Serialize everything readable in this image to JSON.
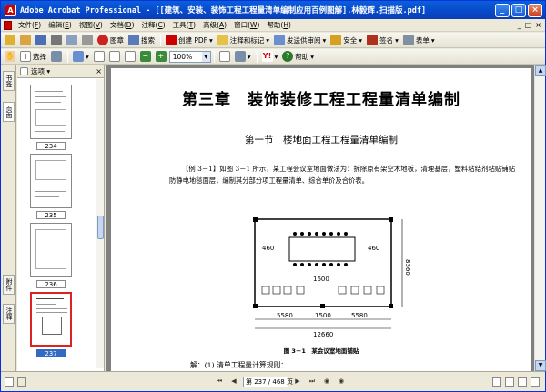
{
  "window": {
    "title": "Adobe Acrobat Professional - [[建筑、安装、装饰工程工程量清单编制应用百例图解].林毅辉.扫描版.pdf]",
    "app_icon": "acrobat-icon",
    "minimize": "_",
    "maximize": "□",
    "close": "×"
  },
  "menu": {
    "items": [
      {
        "label": "文件(",
        "key": "F",
        "end": ")"
      },
      {
        "label": "编辑(",
        "key": "E",
        "end": ")"
      },
      {
        "label": "视图(",
        "key": "V",
        "end": ")"
      },
      {
        "label": "文档(",
        "key": "D",
        "end": ")"
      },
      {
        "label": "注释(",
        "key": "C",
        "end": ")"
      },
      {
        "label": "工具(",
        "key": "T",
        "end": ")"
      },
      {
        "label": "高级(",
        "key": "A",
        "end": ")"
      },
      {
        "label": "窗口(",
        "key": "W",
        "end": ")"
      },
      {
        "label": "帮助(",
        "key": "H",
        "end": ")"
      }
    ],
    "right_min": "_",
    "right_restore": "□",
    "right_close": "×"
  },
  "toolbar1": {
    "print_label": "图章",
    "search_label": "搜索",
    "create_pdf": "创建 PDF",
    "comment": "注释和标记",
    "send_review": "发送供审阅",
    "secure": "安全",
    "sign": "签名",
    "forms": "表单"
  },
  "toolbar2": {
    "select": "选择",
    "zoom": "100%",
    "help": "帮助"
  },
  "nav_panel": {
    "options": "选项",
    "tab_bookmarks": "书签",
    "tab_pages": "页面",
    "tab_attachments": "附件",
    "tab_comments": "注释",
    "thumbnails": [
      "234",
      "235",
      "236",
      "237"
    ]
  },
  "document": {
    "chapter_title": "第三章　装饰装修工程工程量清单编制",
    "section_title": "第一节　楼地面工程工程量清单编制",
    "example_paragraph": "【例 3－1】如图 3－1 所示，某工程会议室地面做法为：拆除原有架空木地板，清理基层，塑料粘结剂粘贴铺贴防静电地毯面层，编制其分部分项工程量清单、综合单价及合价表。",
    "fig_caption": "图 3－1　某会议室地面铺贴",
    "solution_line": "解：(1) 清单工程量计算规则：",
    "dims": {
      "d1": "5580",
      "d2": "1500",
      "d3": "5580",
      "total": "12660",
      "height": "8360",
      "left": "460",
      "right": "460",
      "top": "1600"
    }
  },
  "status": {
    "page_field": "第 237 / 468 页",
    "first": "⏮",
    "prev": "◀",
    "next": "▶",
    "last": "⏭"
  }
}
